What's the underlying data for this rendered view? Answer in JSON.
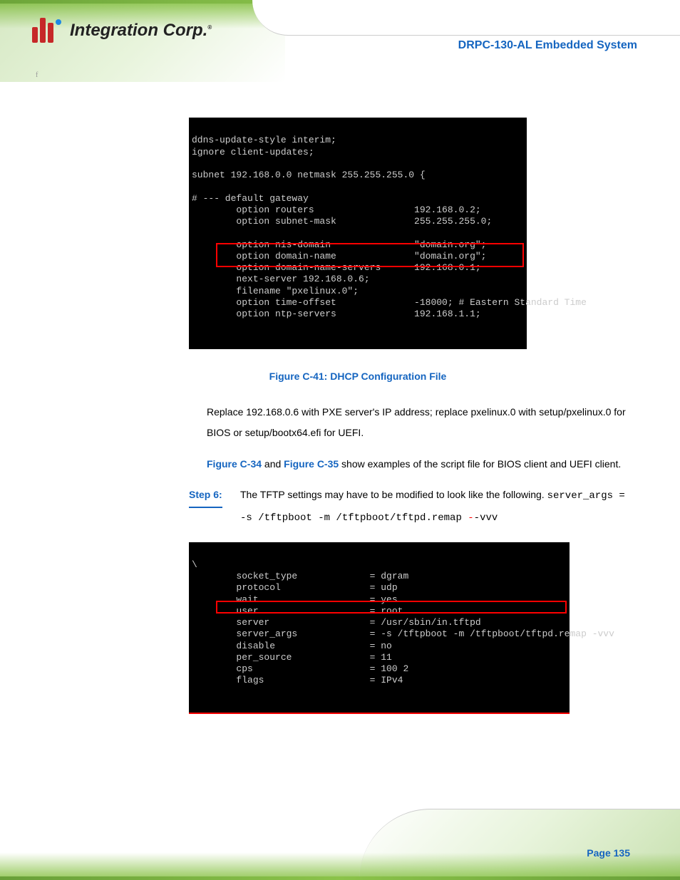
{
  "header": {
    "logo_text": "Integration Corp.",
    "title": "DRPC-130-AL Embedded System",
    "page_label_small": "f"
  },
  "terminal1": {
    "lines": [
      "ddns-update-style interim;",
      "ignore client-updates;",
      "",
      "subnet 192.168.0.0 netmask 255.255.255.0 {",
      "",
      "# --- default gateway",
      "        option routers                  192.168.0.2;",
      "        option subnet-mask              255.255.255.0;",
      "",
      "        option nis-domain               \"domain.org\";",
      "        option domain-name              \"domain.org\";",
      "        option domain-name-servers      192.168.0.1;",
      "        next-server 192.168.0.6;",
      "        filename \"pxelinux.0\";",
      "        option time-offset              -18000; # Eastern Standard Time",
      "        option ntp-servers              192.168.1.1;"
    ]
  },
  "figure1": {
    "caption": "Figure C-41: DHCP Configuration File"
  },
  "body": {
    "para1": "Replace 192.168.0.6 with PXE server's IP address; replace pxelinux.0 with setup/pxelinux.0 for BIOS or setup/bootx64.efi for UEFI.",
    "para2_prefix": "",
    "para2_refA": "Figure C-34",
    "para2_mid": " and ",
    "para2_refB": "Figure C-35",
    "para2_suffix": " show examples of the script file for BIOS client and UEFI client."
  },
  "step": {
    "label": "Step 6:",
    "text_prefix": "The TFTP settings may have to be modified to look like the following. ",
    "mono_pre": "server_args = -s /tftpboot -m /tftpboot/tftpd.remap ",
    "mono_strike": "-",
    "mono_post": "-vvv"
  },
  "terminal2": {
    "lines": [
      "\\",
      "        socket_type             = dgram",
      "        protocol                = udp",
      "        wait                    = yes",
      "        user                    = root",
      "        server                  = /usr/sbin/in.tftpd",
      "        server_args             = -s /tftpboot -m /tftpboot/tftpd.remap -vvv",
      "        disable                 = no",
      "        per_source              = 11",
      "        cps                     = 100 2",
      "        flags                   = IPv4"
    ]
  },
  "footer": {
    "page": "Page 135"
  }
}
